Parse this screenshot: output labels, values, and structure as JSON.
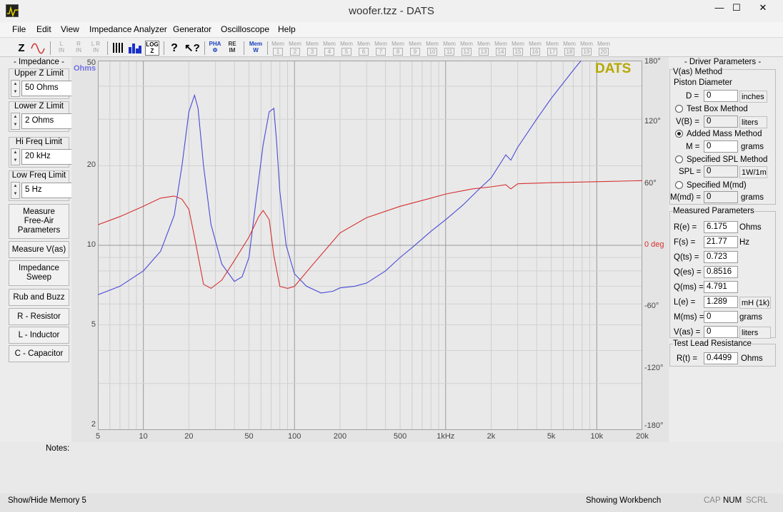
{
  "window": {
    "title": "woofer.tzz - DATS",
    "minimize": "—",
    "maximize": "☐",
    "close": "✕"
  },
  "menu": [
    "File",
    "Edit",
    "View",
    "Impedance Analyzer",
    "Generator",
    "Oscilloscope",
    "Help"
  ],
  "toolbar": {
    "z": "Z",
    "lin": [
      "L",
      "IN"
    ],
    "rin": [
      "R",
      "IN"
    ],
    "lrin": [
      "L R",
      "IN"
    ],
    "log": [
      "LOG",
      "Z"
    ],
    "pha": [
      "PHA",
      "Φ"
    ],
    "reim": [
      "RE",
      "IM"
    ],
    "memw": [
      "Mem",
      "W"
    ],
    "mem_label": "Mem",
    "mem_slots": [
      "1",
      "2",
      "3",
      "4",
      "5",
      "6",
      "7",
      "8",
      "9",
      "10",
      "11",
      "12",
      "13",
      "14",
      "15",
      "16",
      "17",
      "18",
      "19",
      "20"
    ]
  },
  "left_panel": {
    "impedance_title": "- Impedance -",
    "upper_z": {
      "label": "Upper Z Limit",
      "value": "50 Ohms"
    },
    "lower_z": {
      "label": "Lower Z Limit",
      "value": "2 Ohms"
    },
    "hi_freq": {
      "label": "Hi Freq Limit",
      "value": "20 kHz"
    },
    "low_freq": {
      "label": "Low Freq Limit",
      "value": "5 Hz"
    },
    "buttons": [
      "Measure Free-Air Parameters",
      "Measure V(as)",
      "Impedance Sweep",
      "Rub and Buzz",
      "R - Resistor",
      "L - Inductor",
      "C - Capacitor"
    ]
  },
  "chart_data": {
    "type": "line",
    "watermark": "DATS",
    "left_unit": "Ohms",
    "right_zero_label": "0 deg",
    "x_ticks": [
      "5",
      "10",
      "20",
      "50",
      "100",
      "200",
      "500",
      "1kHz",
      "2k",
      "5k",
      "10k",
      "20k"
    ],
    "y_left_ticks": [
      "50",
      "20",
      "10",
      "5",
      "2"
    ],
    "y_right_ticks": [
      "180°",
      "120°",
      "60°",
      "0 deg",
      "-60°",
      "-120°",
      "-180°"
    ],
    "xlim": [
      5,
      20000
    ],
    "ylim_left": [
      2,
      50
    ],
    "ylim_right": [
      -180,
      180
    ],
    "xscale": "log",
    "yscale_left": "log",
    "colors": {
      "impedance": "#4a4ad6",
      "phase": "#d63030",
      "watermark": "#b5a800",
      "ohms_label": "#7070e0",
      "deg_label": "#d63030"
    },
    "series": [
      {
        "name": "",
        "axis": "left",
        "x": [
          5,
          7,
          10,
          13,
          16,
          18,
          20,
          21.8,
          23,
          25,
          28,
          33,
          40,
          45,
          50,
          55,
          62,
          68,
          73,
          76,
          80,
          88,
          100,
          120,
          150,
          180,
          200,
          250,
          300,
          400,
          500,
          600,
          800,
          1000,
          1300,
          1700,
          2000,
          2500,
          2700,
          3000,
          4000,
          5000,
          7000,
          9000
        ],
        "y": [
          6.5,
          7.0,
          8.0,
          9.5,
          13,
          20,
          32,
          37,
          33,
          20,
          12,
          8.5,
          7.3,
          7.6,
          9.0,
          14,
          24,
          32,
          33,
          25,
          16,
          10,
          7.8,
          7.0,
          6.6,
          6.7,
          6.9,
          7.0,
          7.2,
          8.0,
          9.0,
          9.8,
          11.3,
          12.5,
          14.2,
          16.5,
          18.0,
          22,
          21,
          23.5,
          30,
          36,
          46,
          55
        ]
      },
      {
        "name": "",
        "axis": "right",
        "x": [
          5,
          7,
          10,
          13,
          16,
          18,
          20,
          22,
          25,
          28,
          33,
          40,
          50,
          58,
          62,
          68,
          73,
          80,
          90,
          100,
          130,
          170,
          200,
          300,
          500,
          800,
          1000,
          1500,
          2000,
          2500,
          2700,
          3000,
          5000,
          10000,
          20000
        ],
        "y": [
          20,
          28,
          38,
          46,
          48,
          45,
          35,
          5,
          -38,
          -42,
          -34,
          -15,
          8,
          28,
          34,
          25,
          -10,
          -40,
          -42,
          -40,
          -20,
          0,
          12,
          27,
          38,
          46,
          50,
          55,
          57,
          59,
          55,
          60,
          61,
          62,
          63
        ]
      }
    ]
  },
  "right_panel": {
    "driver_title": "- Driver Parameters -",
    "vas_method": "V(as) Method",
    "piston_diameter": "Piston Diameter",
    "d": {
      "label": "D =",
      "value": "0",
      "unit": "inches"
    },
    "test_box": "Test Box Method",
    "vb": {
      "label": "V(B) =",
      "value": "0",
      "unit": "liters"
    },
    "added_mass": "Added Mass Method",
    "m": {
      "label": "M =",
      "value": "0",
      "unit": "grams"
    },
    "specified_spl": "Specified SPL Method",
    "spl": {
      "label": "SPL =",
      "value": "0",
      "unit": "1W/1m"
    },
    "specified_mmd": "Specified M(md)",
    "mmd": {
      "label": "M(md) =",
      "value": "0",
      "unit": "grams"
    },
    "measured_title": "Measured Parameters",
    "measured": [
      {
        "label": "R(e) =",
        "value": "6.175",
        "unit": "Ohms"
      },
      {
        "label": "F(s) =",
        "value": "21.77",
        "unit": "Hz"
      },
      {
        "label": "Q(ts) =",
        "value": "0.723",
        "unit": ""
      },
      {
        "label": "Q(es) =",
        "value": "0.8516",
        "unit": ""
      },
      {
        "label": "Q(ms) =",
        "value": "4.791",
        "unit": ""
      },
      {
        "label": "L(e) =",
        "value": "1.289",
        "unit": "mH (1k)"
      },
      {
        "label": "M(ms) =",
        "value": "0",
        "unit": "grams"
      },
      {
        "label": "V(as) =",
        "value": "0",
        "unit": "liters"
      }
    ],
    "lead_title": "Test Lead Resistance",
    "rt": {
      "label": "R(t) =",
      "value": "0.4499",
      "unit": "Ohms"
    }
  },
  "notes_label": "Notes:",
  "status": {
    "left": "Show/Hide Memory 5",
    "middle": "Showing Workbench",
    "caps": "CAP",
    "num": "NUM",
    "scrl": "SCRL"
  }
}
